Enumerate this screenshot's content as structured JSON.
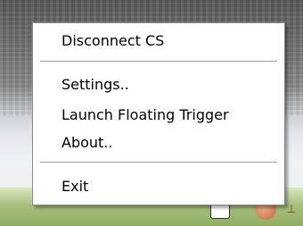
{
  "context_menu": {
    "items": [
      {
        "label": "Disconnect CS"
      },
      {
        "label": "Settings.."
      },
      {
        "label": "Launch Floating Trigger"
      },
      {
        "label": "About.."
      },
      {
        "label": "Exit"
      }
    ]
  },
  "taskbar": {
    "tray_icons": [
      "chat-icon",
      "orange-app-icon",
      "network-icon"
    ]
  }
}
